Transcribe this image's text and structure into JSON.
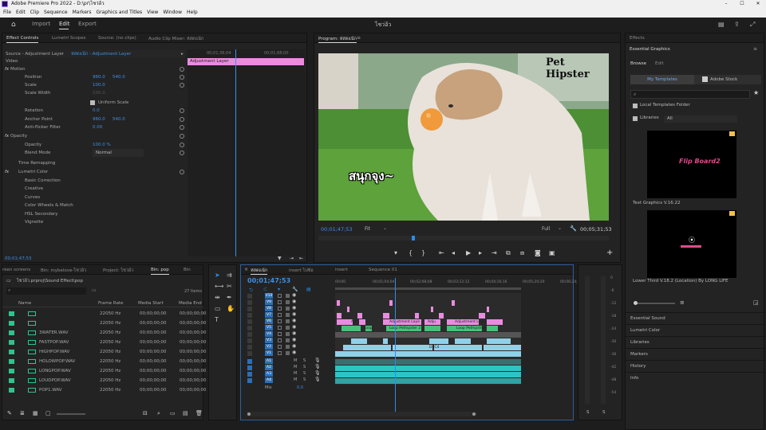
{
  "app": {
    "title": "Adobe Premiere Pro 2022 - D:\\pr\\ไชว่อ้ว",
    "project_name": "ไชว่อ้ว"
  },
  "menu": [
    "File",
    "Edit",
    "Clip",
    "Sequence",
    "Markers",
    "Graphics and Titles",
    "View",
    "Window",
    "Help"
  ],
  "workspace_tabs": [
    "Import",
    "Edit",
    "Export"
  ],
  "effect_controls": {
    "tabs": [
      "Effect Controls",
      "Lumetri Scopes",
      "Source: (no clips)",
      "Audio Clip Mixer: ห่สดแน้ก"
    ],
    "source_label": "Source - Adjustment Layer",
    "clip_label": "ห่สดแน้ก - Adjustment Layer",
    "clip_bar_label": "Adjustment Layer",
    "ruler_times": [
      "00;01;36;04",
      "00;01;68;00"
    ],
    "section_video": "Video",
    "props": [
      {
        "name": "Motion",
        "v1": "",
        "v2": ""
      },
      {
        "name": "Position",
        "v1": "960.0",
        "v2": "540.0"
      },
      {
        "name": "Scale",
        "v1": "100.0",
        "v2": ""
      },
      {
        "name": "Scale Width",
        "v1": "100.0",
        "v2": ""
      },
      {
        "name": "Uniform Scale",
        "v1": "",
        "v2": ""
      },
      {
        "name": "Rotation",
        "v1": "0.0",
        "v2": ""
      },
      {
        "name": "Anchor Point",
        "v1": "960.0",
        "v2": "540.0"
      },
      {
        "name": "Anti-flicker Filter",
        "v1": "0.00",
        "v2": ""
      },
      {
        "name": "Opacity",
        "v1": "",
        "v2": ""
      },
      {
        "name": "Opacity",
        "v1": "100.0 %",
        "v2": ""
      },
      {
        "name": "Blend Mode",
        "v1": "Normal",
        "v2": ""
      },
      {
        "name": "Time Remapping",
        "v1": "",
        "v2": ""
      },
      {
        "name": "Lumetri Color",
        "v1": "",
        "v2": ""
      },
      {
        "name": "Basic Correction",
        "v1": "",
        "v2": ""
      },
      {
        "name": "Creative",
        "v1": "",
        "v2": ""
      },
      {
        "name": "Curves",
        "v1": "",
        "v2": ""
      },
      {
        "name": "Color Wheels & Match",
        "v1": "",
        "v2": ""
      },
      {
        "name": "HSL Secondary",
        "v1": "",
        "v2": ""
      },
      {
        "name": "Vignette",
        "v1": "",
        "v2": ""
      }
    ],
    "timecode": "00;01;47;53"
  },
  "program": {
    "tab": "Program: ห่สดแน้ก",
    "overlay_brand": "Pet Hipster",
    "overlay_caption": "สนุกจุง~",
    "timecode": "00;01;47;53",
    "fit": "Fit",
    "quality": "Full",
    "duration": "00;05;31;53"
  },
  "project": {
    "tabs": [
      "reen screens",
      "Bin: mybelove-ไชว่อ้ว",
      "Project: ไชว่อ้ว",
      "Bin: pop",
      "Bin"
    ],
    "path": "ไชว่อ้ว.prproj\\Sound Effect\\pop",
    "items_count": "27 Items",
    "columns": [
      "Name",
      "Frame Rate",
      "Media Start",
      "Media End"
    ],
    "rows": [
      {
        "name": "",
        "rate": "22050 Hz",
        "start": "00;00;00;00",
        "end": "00;00;00;00"
      },
      {
        "name": "",
        "rate": "22050 Hz",
        "start": "00;00;00;00",
        "end": "00;00;00;00"
      },
      {
        "name": "3WATER.WAV",
        "rate": "22050 Hz",
        "start": "00;00;00;00",
        "end": "00;00;00;00"
      },
      {
        "name": "FASTPOP.WAV",
        "rate": "22050 Hz",
        "start": "00;00;00;00",
        "end": "00;00;00;00"
      },
      {
        "name": "HIGHPOP.WAV",
        "rate": "22050 Hz",
        "start": "00;00;00;00",
        "end": "00;00;00;00"
      },
      {
        "name": "HOLOWPOP.WAV",
        "rate": "22050 Hz",
        "start": "00;00;00;00",
        "end": "00;00;00;00"
      },
      {
        "name": "LONGPOP.WAV",
        "rate": "22050 Hz",
        "start": "00;00;00;00",
        "end": "00;00;00;00"
      },
      {
        "name": "LOUDPOP.WAV",
        "rate": "22050 Hz",
        "start": "00;00;00;00",
        "end": "00;00;00;00"
      },
      {
        "name": "POP1.WAV",
        "rate": "22050 Hz",
        "start": "00;00;00;00",
        "end": "00;00;00;00"
      }
    ]
  },
  "timeline": {
    "tabs": [
      "ห่สดแน้ก",
      "insert ไปซ้อ",
      "insert",
      "Sequence 01"
    ],
    "timecode": "00;01;47;53",
    "ruler": [
      "00;00",
      "00;01;04;04",
      "00;02;08;08",
      "00;03;12;12",
      "00;04;16;16",
      "00;05;20;20",
      "00;06;24;24"
    ],
    "video_tracks": [
      "V10",
      "V9",
      "V8",
      "V7",
      "V6",
      "V5",
      "V4",
      "V3",
      "V2",
      "V1"
    ],
    "audio_tracks": [
      "A1",
      "A2",
      "A3",
      "A4"
    ],
    "mix_label": "Mix",
    "mix_value": "0.0",
    "clip_labels": [
      "Adju",
      "Adjustment Laye",
      "Adjustment Laye",
      "Adju",
      "Loop",
      "Loop Pethipster 2",
      "Loop Pethipster",
      "DSC4"
    ],
    "meter_scale": [
      "0",
      "-6",
      "-12",
      "-18",
      "-24",
      "-30",
      "-36",
      "-42",
      "-48",
      "-54"
    ],
    "meter_bottom": [
      "S",
      "S"
    ]
  },
  "right": {
    "effects_tab": "Effects",
    "eg_title": "Essential Graphics",
    "eg_tabs": [
      "Browse",
      "Edit"
    ],
    "sub_tabs": [
      "My Templates",
      "Adobe Stock"
    ],
    "local_folder": "Local Templates Folder",
    "libraries": "Libraries",
    "libraries_value": "All",
    "templates": [
      {
        "title": "Text Graphics V.16.22",
        "preview": "Flip Board2"
      },
      {
        "title": "Lower Third V.18.2 (Location) By LONG LIFE",
        "preview": ""
      }
    ],
    "panels": [
      "Essential Sound",
      "Lumetri Color",
      "Libraries",
      "Markers",
      "History",
      "Info"
    ]
  },
  "colors": {
    "accent": "#2d8ceb",
    "adjustment": "#e98ce0",
    "video": "#8fd1e8",
    "green": "#49c17a",
    "audio": "#2fc3c3",
    "brand": "#9999ff"
  }
}
